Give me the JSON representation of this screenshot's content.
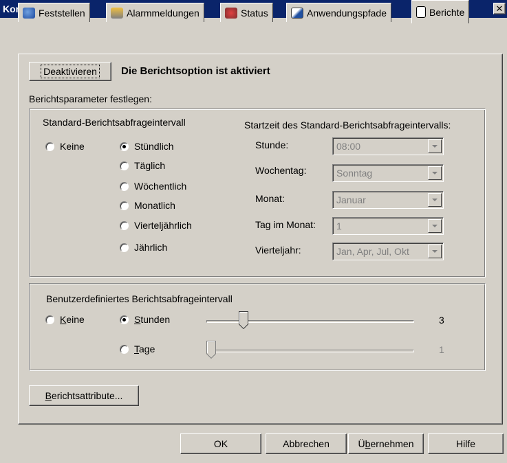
{
  "window": {
    "title": "Konfiguration",
    "close": "✕"
  },
  "tabs": [
    {
      "label": "Feststellen",
      "icon": "wrench-globe-icon"
    },
    {
      "label": "Alarmmeldungen",
      "icon": "alarm-printer-icon"
    },
    {
      "label": "Status",
      "icon": "status-gauge-icon"
    },
    {
      "label": "Anwendungspfade",
      "icon": "path-icon"
    },
    {
      "label": "Berichte",
      "icon": "report-icon"
    }
  ],
  "active_tab": "Berichte",
  "report": {
    "deactivate_button": "Deaktivieren",
    "status_text": "Die Berichtsoption ist aktiviert",
    "params_label": "Berichtsparameter festlegen:"
  },
  "standard": {
    "group_label": "Standard-Berichtsabfrageintervall",
    "none": "Keine",
    "options": [
      "Stündlich",
      "Täglich",
      "Wöchentlich",
      "Monatlich",
      "Vierteljährlich",
      "Jährlich"
    ],
    "selected": "Stündlich",
    "start_label": "Startzeit des Standard-Berichtsabfrageintervalls:",
    "fields": {
      "hour": {
        "label": "Stunde:",
        "value": "08:00"
      },
      "weekday": {
        "label": "Wochentag:",
        "value": "Sonntag"
      },
      "month": {
        "label": "Monat:",
        "value": "Januar"
      },
      "day": {
        "label": "Tag im Monat:",
        "value": "1"
      },
      "quarter": {
        "label": "Vierteljahr:",
        "value": "Jan, Apr, Jul, Okt"
      }
    }
  },
  "custom": {
    "group_label": "Benutzerdefiniertes Berichtsabfrageintervall",
    "none_k": "K",
    "none_rest": "eine",
    "hours_k": "S",
    "hours_rest": "tunden",
    "days_k": "T",
    "days_rest": "age",
    "selected": "Stunden",
    "hours_value": "3",
    "days_value": "1",
    "hours_fraction": 0.12,
    "days_fraction": 0.0
  },
  "attributes_button": {
    "k": "B",
    "rest": "erichtsattribute..."
  },
  "footer": {
    "ok": "OK",
    "cancel": "Abbrechen",
    "apply_pre": "Ü",
    "apply_rest": "bernehmen",
    "help": "Hilfe"
  }
}
